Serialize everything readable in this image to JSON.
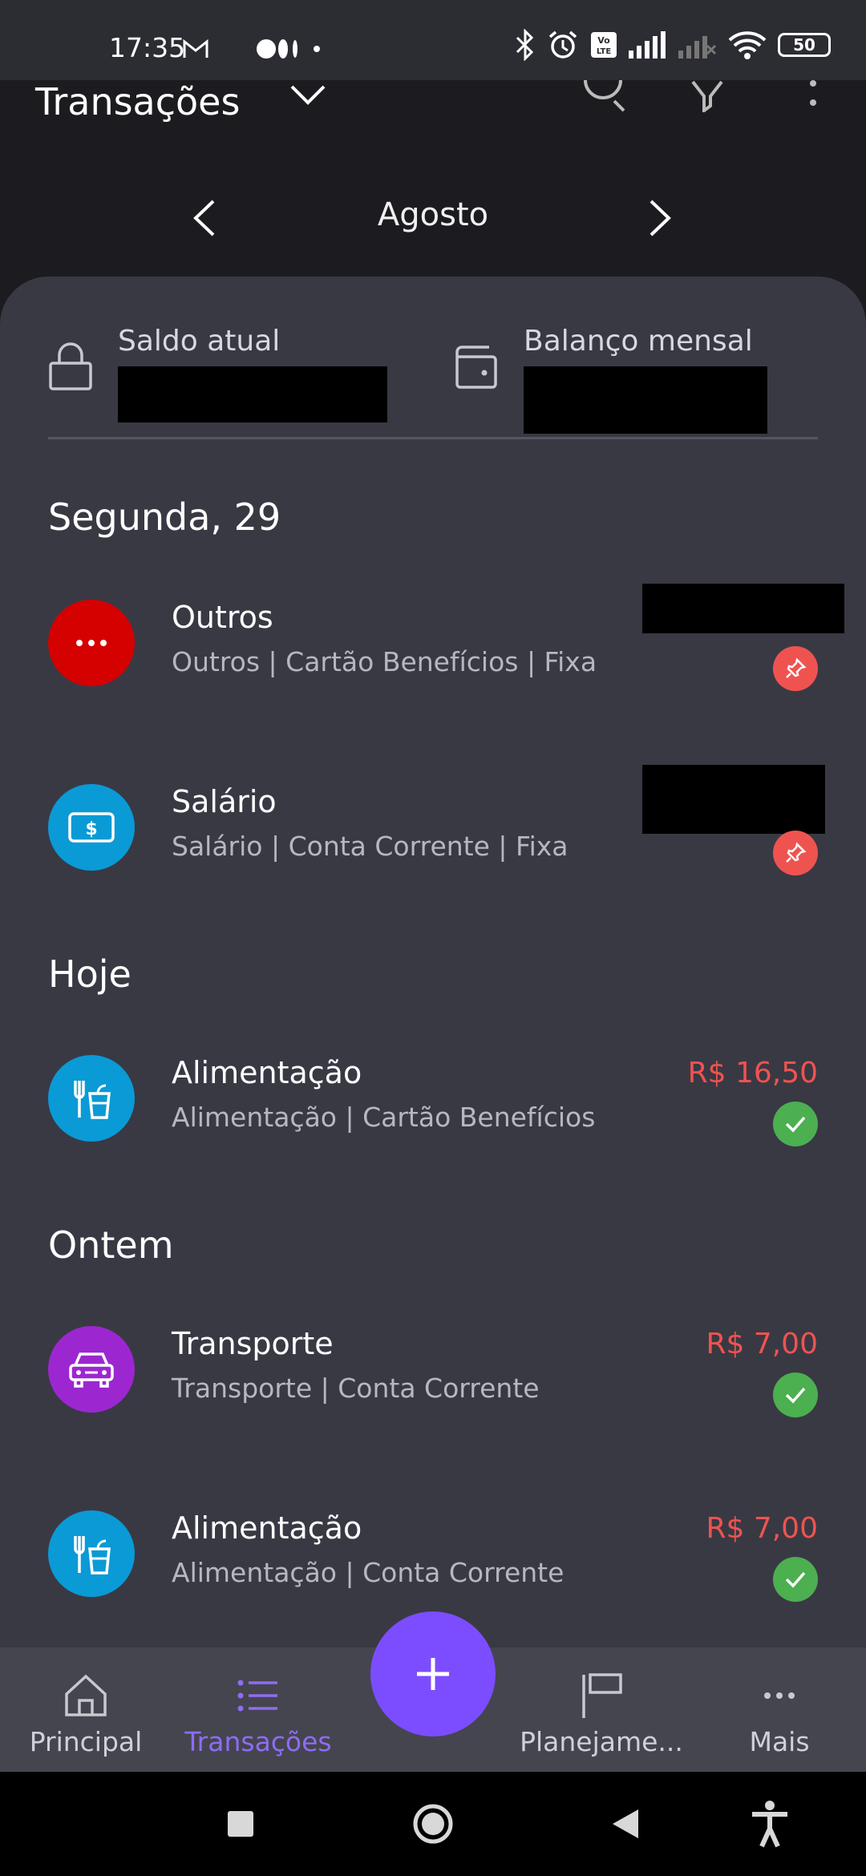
{
  "status_bar": {
    "time": "17:35",
    "battery": "50"
  },
  "app_bar": {
    "title": "Transações"
  },
  "month": {
    "label": "Agosto"
  },
  "summary": {
    "current_balance_label": "Saldo atual",
    "monthly_balance_label": "Balanço mensal"
  },
  "groups": [
    {
      "header": "Segunda, 29",
      "items": [
        {
          "name": "Outros",
          "details": "Outros | Cartão Benefícios | Fixa",
          "amount": "",
          "status": "pinned",
          "icon": "more-dots-icon",
          "color": "#d50000"
        },
        {
          "name": "Salário",
          "details": "Salário | Conta Corrente | Fixa",
          "amount": "",
          "status": "pinned",
          "icon": "money-bill-icon",
          "color": "#0a9ad6"
        }
      ]
    },
    {
      "header": "Hoje",
      "items": [
        {
          "name": "Alimentação",
          "details": "Alimentação | Cartão Benefícios",
          "amount": "R$ 16,50",
          "status": "paid",
          "icon": "food-drink-icon",
          "color": "#0a9ad6"
        }
      ]
    },
    {
      "header": "Ontem",
      "items": [
        {
          "name": "Transporte",
          "details": "Transporte | Conta Corrente",
          "amount": "R$ 7,00",
          "status": "paid",
          "icon": "car-icon",
          "color": "#9c27d0"
        },
        {
          "name": "Alimentação",
          "details": "Alimentação | Conta Corrente",
          "amount": "R$ 7,00",
          "status": "paid",
          "icon": "food-drink-icon",
          "color": "#0a9ad6"
        }
      ]
    }
  ],
  "bottom_nav": {
    "items": [
      {
        "label": "Principal",
        "icon": "home-icon"
      },
      {
        "label": "Transações",
        "icon": "list-icon",
        "active": true
      },
      {
        "label": "Planejame...",
        "icon": "flag-icon"
      },
      {
        "label": "Mais",
        "icon": "more-horizontal-icon"
      }
    ],
    "fab_icon": "plus-icon"
  },
  "colors": {
    "accent": "#7c4dff",
    "expense": "#ef5350",
    "paid": "#4caf50",
    "sheet": "#393944"
  }
}
